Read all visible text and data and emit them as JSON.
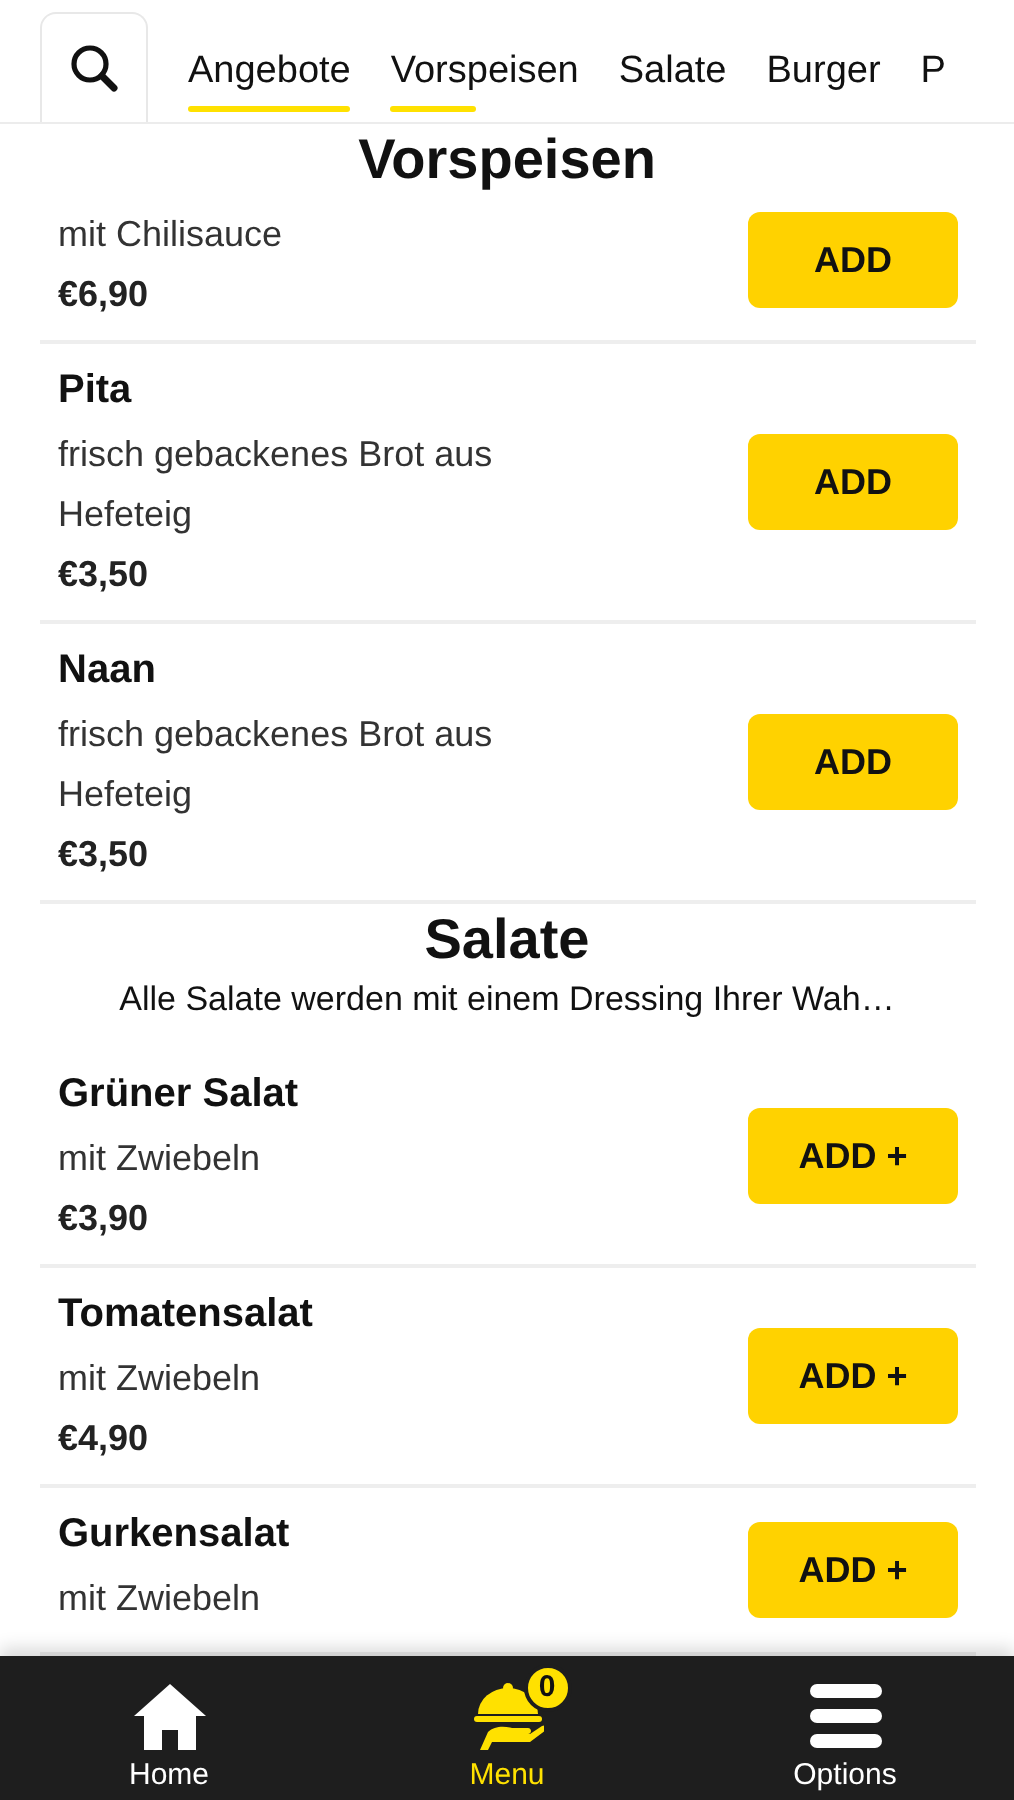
{
  "tabs": [
    {
      "label": "Angebote",
      "level": 1
    },
    {
      "label": "Vorspeisen",
      "level": 0.45
    },
    {
      "label": "Salate"
    },
    {
      "label": "Burger"
    },
    {
      "label": "P"
    }
  ],
  "sections": [
    {
      "title": "Vorspeisen",
      "items": [
        {
          "description": "mit Chilisauce",
          "price": "€6,90",
          "button": "ADD"
        },
        {
          "name": "Pita",
          "description": "frisch gebackenes Brot aus Hefeteig",
          "price": "€3,50",
          "button": "ADD"
        },
        {
          "name": "Naan",
          "description": "frisch gebackenes Brot aus Hefeteig",
          "price": "€3,50",
          "button": "ADD"
        }
      ]
    },
    {
      "title": "Salate",
      "subtitle": "Alle Salate werden mit einem Dressing Ihrer Wah…",
      "items": [
        {
          "name": "Grüner Salat",
          "description": "mit Zwiebeln",
          "price": "€3,90",
          "button": "ADD +"
        },
        {
          "name": "Tomatensalat",
          "description": "mit Zwiebeln",
          "price": "€4,90",
          "button": "ADD +"
        },
        {
          "name": "Gurkensalat",
          "description": "mit Zwiebeln",
          "button": "ADD +"
        }
      ]
    }
  ],
  "bottom_nav": [
    {
      "kind": "home",
      "label": "Home",
      "selected": false
    },
    {
      "kind": "menu",
      "label": "Menu",
      "selected": true,
      "badge": "0"
    },
    {
      "kind": "options",
      "label": "Options",
      "selected": false
    }
  ]
}
